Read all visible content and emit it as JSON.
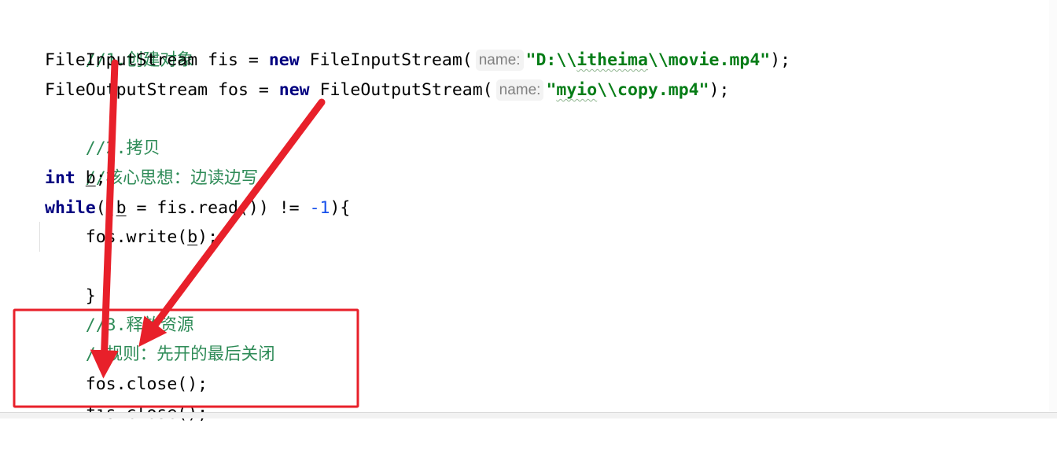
{
  "code": {
    "line1": {
      "comment": "//1.创建对象"
    },
    "line2": {
      "type": "FileInputStream",
      "var": "fis",
      "eq": "=",
      "new_kw": "new",
      "ctor": "FileInputStream(",
      "hint": "name:",
      "str_pre": "\"D:\\\\",
      "str_mid": "itheima",
      "str_post": "\\\\movie.mp4\"",
      "end": ");"
    },
    "line3": {
      "type": "FileOutputStream",
      "var": "fos",
      "eq": "=",
      "new_kw": "new",
      "ctor": "FileOutputStream(",
      "hint": "name:",
      "str_pre": "\"",
      "str_mid": "myio",
      "str_post": "\\\\copy.mp4\"",
      "end": ");"
    },
    "line4": {
      "comment": "//2.拷贝"
    },
    "line5": {
      "comment": "//核心思想：边读边写"
    },
    "line6": {
      "kw": "int",
      "var": "b",
      "end": ";"
    },
    "line7": {
      "kw": "while",
      "open": "((",
      "var": "b",
      "mid": " = fis.read()) != ",
      "num": "-1",
      "end": "){"
    },
    "line8": {
      "pre": "    fos.write(",
      "var": "b",
      "end": ");"
    },
    "line9": {
      "text": "}"
    },
    "line10": {
      "comment": "//3.释放资源"
    },
    "line11": {
      "comment": "//规则：先开的最后关闭"
    },
    "line12": {
      "text": "fos.close();"
    },
    "line13": {
      "text": "fis.close();"
    }
  },
  "annotation": {
    "highlight_color": "#e8202a",
    "arrow_color": "#e8202a"
  }
}
